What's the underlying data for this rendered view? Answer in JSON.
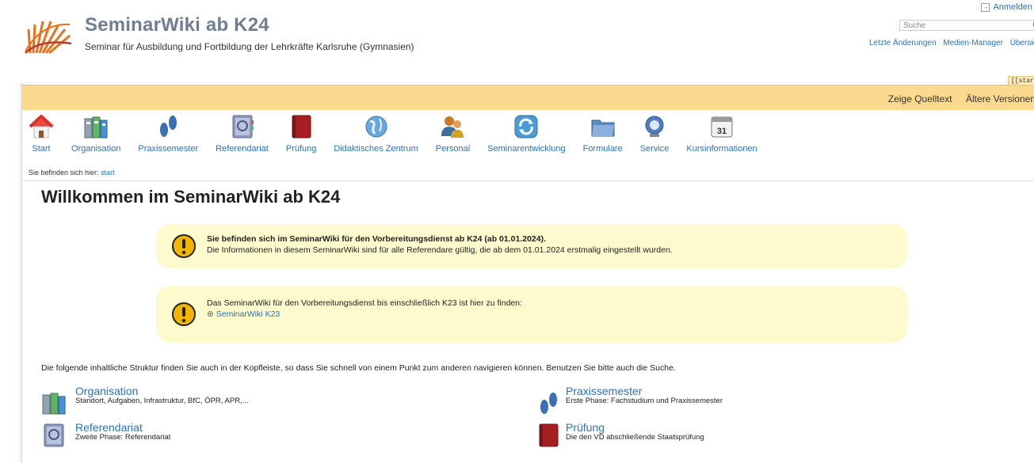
{
  "header": {
    "login": "Anmelden",
    "title": "SeminarWiki ab K24",
    "subtitle": "Seminar für Ausbildung und Fortbildung der Lehrkräfte Karlsruhe (Gymnasien)",
    "search_placeholder": "Suche",
    "tools": [
      "Letzte Änderungen",
      "Medien-Manager",
      "Übersicht"
    ],
    "pagename_tag": "[[start]]"
  },
  "pagebar": {
    "show_source": "Zeige Quelltext",
    "old_versions": "Ältere Versionen"
  },
  "nav": [
    {
      "label": "Start",
      "icon": "home-icon"
    },
    {
      "label": "Organisation",
      "icon": "organisation-icon"
    },
    {
      "label": "Praxissemester",
      "icon": "footprints-icon"
    },
    {
      "label": "Referendariat",
      "icon": "address-book-icon"
    },
    {
      "label": "Prüfung",
      "icon": "notebook-icon"
    },
    {
      "label": "Didaktisches Zentrum",
      "icon": "globe-icon"
    },
    {
      "label": "Personal",
      "icon": "people-icon"
    },
    {
      "label": "Seminarentwicklung",
      "icon": "refresh-icon"
    },
    {
      "label": "Formulare",
      "icon": "folder-icon"
    },
    {
      "label": "Service",
      "icon": "support-icon"
    },
    {
      "label": "Kursinformationen",
      "icon": "calendar-icon"
    }
  ],
  "calendar_day": "31",
  "breadcrumb": {
    "prefix": "Sie befinden sich hier:",
    "current": "start"
  },
  "page_title": "Willkommen im SeminarWiki ab K24",
  "notice1": {
    "bold": "Sie befinden sich im SeminarWiki für den Vorbereitungsdienst ab K24 (ab 01.01.2024).",
    "text": "Die Informationen in diesem SeminarWiki sind für alle Referendare gültig, die ab dem 01.01.2024 erstmalig eingestellt wurden."
  },
  "notice2": {
    "text": "Das SeminarWiki für den Vorbereitungsdienst bis einschließlich K23 ist hier zu finden:",
    "link": "SeminarWiki K23"
  },
  "intro": "Die folgende inhaltliche Struktur finden Sie auch in der Kopfleiste, so dass Sie schnell von einem Punkt zum anderen navigieren können. Benutzen Sie bitte auch die Suche.",
  "entries": [
    {
      "title": "Organisation",
      "desc": "Standort, Aufgaben, Infrastruktur, BfC, ÖPR, APR,..."
    },
    {
      "title": "Praxissemester",
      "desc": "Erste Phase: Fachstudium und Praxissemester"
    },
    {
      "title": "Referendariat",
      "desc": "Zweite Phase: Referendariat"
    },
    {
      "title": "Prüfung",
      "desc": "Die den VD abschließende Staatsprüfung"
    }
  ],
  "colors": {
    "accent": "#2b73b7",
    "pagebar": "#fbd98e",
    "notice": "#fdfbcd",
    "title": "#6f7f8f"
  }
}
